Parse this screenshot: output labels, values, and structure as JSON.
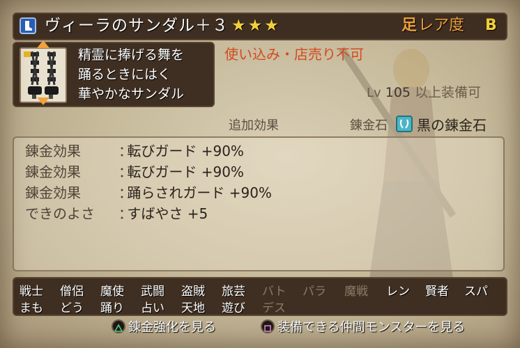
{
  "item": {
    "name": "ヴィーラのサンダル＋３",
    "stars": "★★★",
    "slot": "足",
    "rarity_label": "レア度",
    "rarity": "B",
    "description": [
      "精霊に捧げる舞を",
      "踊るときにはく",
      "華やかなサンダル"
    ],
    "restriction": "使い込み・店売り不可",
    "level_prefix": "Lv",
    "level": "105",
    "level_suffix": "以上装備可",
    "icons": {
      "slot": "boot-icon",
      "image": "sandals-icon"
    }
  },
  "alchemy": {
    "extra_label": "追加効果",
    "stone_label": "錬金石",
    "stone_icon": "alchemy-stone-icon",
    "stone_name": "黒の錬金石"
  },
  "effects": [
    {
      "name": "錬金効果",
      "value": "転びガード +90%"
    },
    {
      "name": "錬金効果",
      "value": "転びガード +90%"
    },
    {
      "name": "錬金効果",
      "value": "踊らされガード +90%"
    },
    {
      "name": "できのよさ",
      "value": "すばやさ +5"
    }
  ],
  "effect_separator": "：",
  "jobs": [
    {
      "label": "戦士",
      "active": true
    },
    {
      "label": "僧侶",
      "active": true
    },
    {
      "label": "魔使",
      "active": true
    },
    {
      "label": "武闘",
      "active": true
    },
    {
      "label": "盗賊",
      "active": true
    },
    {
      "label": "旅芸",
      "active": true
    },
    {
      "label": "バト",
      "active": false
    },
    {
      "label": "パラ",
      "active": false
    },
    {
      "label": "魔戦",
      "active": false
    },
    {
      "label": "レン",
      "active": true
    },
    {
      "label": "賢者",
      "active": true
    },
    {
      "label": "スパ",
      "active": true
    },
    {
      "label": "まも",
      "active": true
    },
    {
      "label": "どう",
      "active": true
    },
    {
      "label": "踊り",
      "active": true
    },
    {
      "label": "占い",
      "active": true
    },
    {
      "label": "天地",
      "active": true
    },
    {
      "label": "遊び",
      "active": true
    },
    {
      "label": "デス",
      "active": false
    }
  ],
  "hints": {
    "triangle": {
      "symbol": "△",
      "label": "錬金強化を見る"
    },
    "square": {
      "symbol": "□",
      "label": "装備できる仲間モンスターを見る"
    }
  },
  "colors": {
    "star": "#f5d33a",
    "rarity": "#f0a23e",
    "restriction": "#d34a1f",
    "job_active": "#ffffff",
    "job_inactive": "#8a7a66"
  }
}
